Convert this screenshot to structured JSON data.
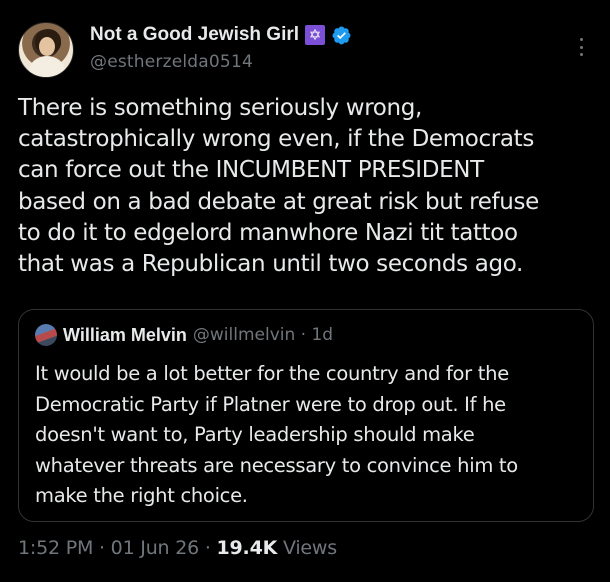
{
  "author": {
    "display_name": "Not a Good Jewish Girl",
    "name_emoji": "✡",
    "handle": "@estherzelda0514",
    "verified_icon": "verified-badge-icon",
    "avatar_icon": "portrait-avatar"
  },
  "tweet": {
    "lines": [
      "There is something seriously wrong,",
      "catastrophically wrong even, if the Democrats",
      "can force out the INCUMBENT PRESIDENT",
      "based on a bad debate at great risk but refuse",
      "to do it to edgelord manwhore Nazi tit tattoo",
      "that was a Republican until two seconds ago."
    ]
  },
  "quote": {
    "display_name": "William Melvin",
    "handle_time": "@willmelvin · 1d",
    "lines": [
      "It would be a lot better for the country and for the",
      "Democratic Party if Platner were to drop out. If he",
      "doesn't want to, Party leadership should make",
      "whatever threats are necessary to convince him to",
      "make the right choice."
    ]
  },
  "meta": {
    "time_date": "1:52 PM · 01 Jun 26 · ",
    "views_count": "19.4K",
    "views_label": " Views"
  },
  "colors": {
    "background": "#000000",
    "text": "#e7e9ea",
    "secondary": "#71767b",
    "verified": "#1d9bf0",
    "emoji_box": "#7b4fd6",
    "border": "#2f3336"
  }
}
